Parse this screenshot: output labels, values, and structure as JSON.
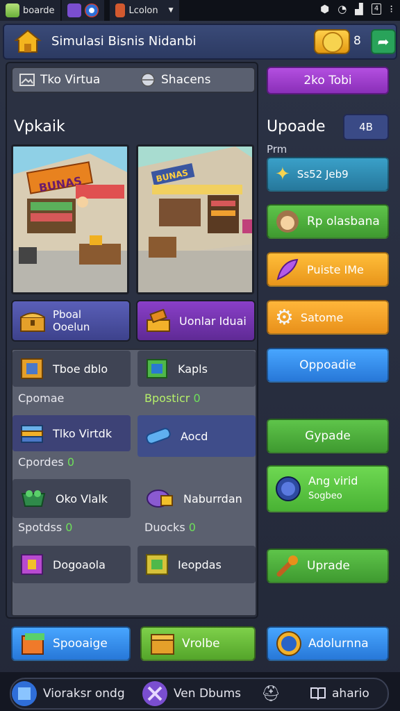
{
  "status_bar": {
    "apps": [
      {
        "label": "boarde",
        "icon": "cube-app-icon",
        "color": "#9bd45a"
      },
      {
        "label": "",
        "icon": "purple-app-icon",
        "color": "#7a4ed0"
      },
      {
        "label": "",
        "icon": "chrome-app-icon",
        "color": "#2c6fd6"
      },
      {
        "label": "Lcolon",
        "icon": "orange-app-icon",
        "color": "#d2592f"
      }
    ],
    "battery": "4"
  },
  "header": {
    "title": "Simulasi Bisnis Nidanbi",
    "coin_value": "8"
  },
  "tabs": {
    "tab1": "Tko Virtua",
    "tab2": "Shacens",
    "promo_button": "2ko Tobi"
  },
  "left_section": {
    "title": "Vpkaik"
  },
  "right_section": {
    "title": "Upoade",
    "badge": "4B",
    "subtitle": "Prm"
  },
  "shop_cards": {
    "card1_sign": "BUNAS",
    "card2_sign": "BUNAS",
    "card1_button": [
      "Pboal",
      "Ooelun"
    ],
    "card2_button": "Uonlar Iduai"
  },
  "items": {
    "row1": [
      "Tboe dblo",
      "Kapls"
    ],
    "label1": [
      "Cpomae",
      "Bposticr",
      "0"
    ],
    "row2": [
      "Tlko Virtdk",
      "Aocd"
    ],
    "label2": [
      "Cpordes",
      "0"
    ],
    "row3": [
      "Oko Vlalk",
      "Naburrdan"
    ],
    "label3": [
      "Spotdss",
      "0",
      "Duocks",
      "0"
    ],
    "row4": [
      "Dogoaola",
      "Ieopdas"
    ]
  },
  "right_buttons": [
    {
      "label": "Ss52 Jeb9",
      "icon": "star-icon",
      "color": "#2f86b6"
    },
    {
      "label": "Rp olasbana",
      "icon": "character-icon",
      "color": "#4cae3a"
    },
    {
      "label": "Puiste IMe",
      "icon": "feather-icon",
      "color": "#f4a81f"
    },
    {
      "label": "Satome",
      "icon": "gear-icon",
      "color": "#f3a11f"
    },
    {
      "label": "Oppoadie",
      "icon": "",
      "color": "#2f8ff0"
    },
    {
      "label": "Gypade",
      "icon": "",
      "color": "#4cae3a"
    },
    {
      "label": "Ang virid",
      "sublabel": "Sogbeo",
      "icon": "globe-icon",
      "color": "#59c840"
    },
    {
      "label": "Uprade",
      "icon": "wrench-icon",
      "color": "#4cae3a"
    }
  ],
  "bottom_buttons": [
    {
      "label": "Spooaige",
      "icon": "cube-icon",
      "color": "#2f8ff0"
    },
    {
      "label": "Vrolbe",
      "icon": "box-icon",
      "color": "#6bbf3a"
    },
    {
      "label": "Adolurnna",
      "icon": "clock-icon",
      "color": "#2f8ff0"
    }
  ],
  "navbar": {
    "item1": "Vioraksr ondg",
    "item2": "Ven Dbums",
    "item4": "ahario"
  }
}
